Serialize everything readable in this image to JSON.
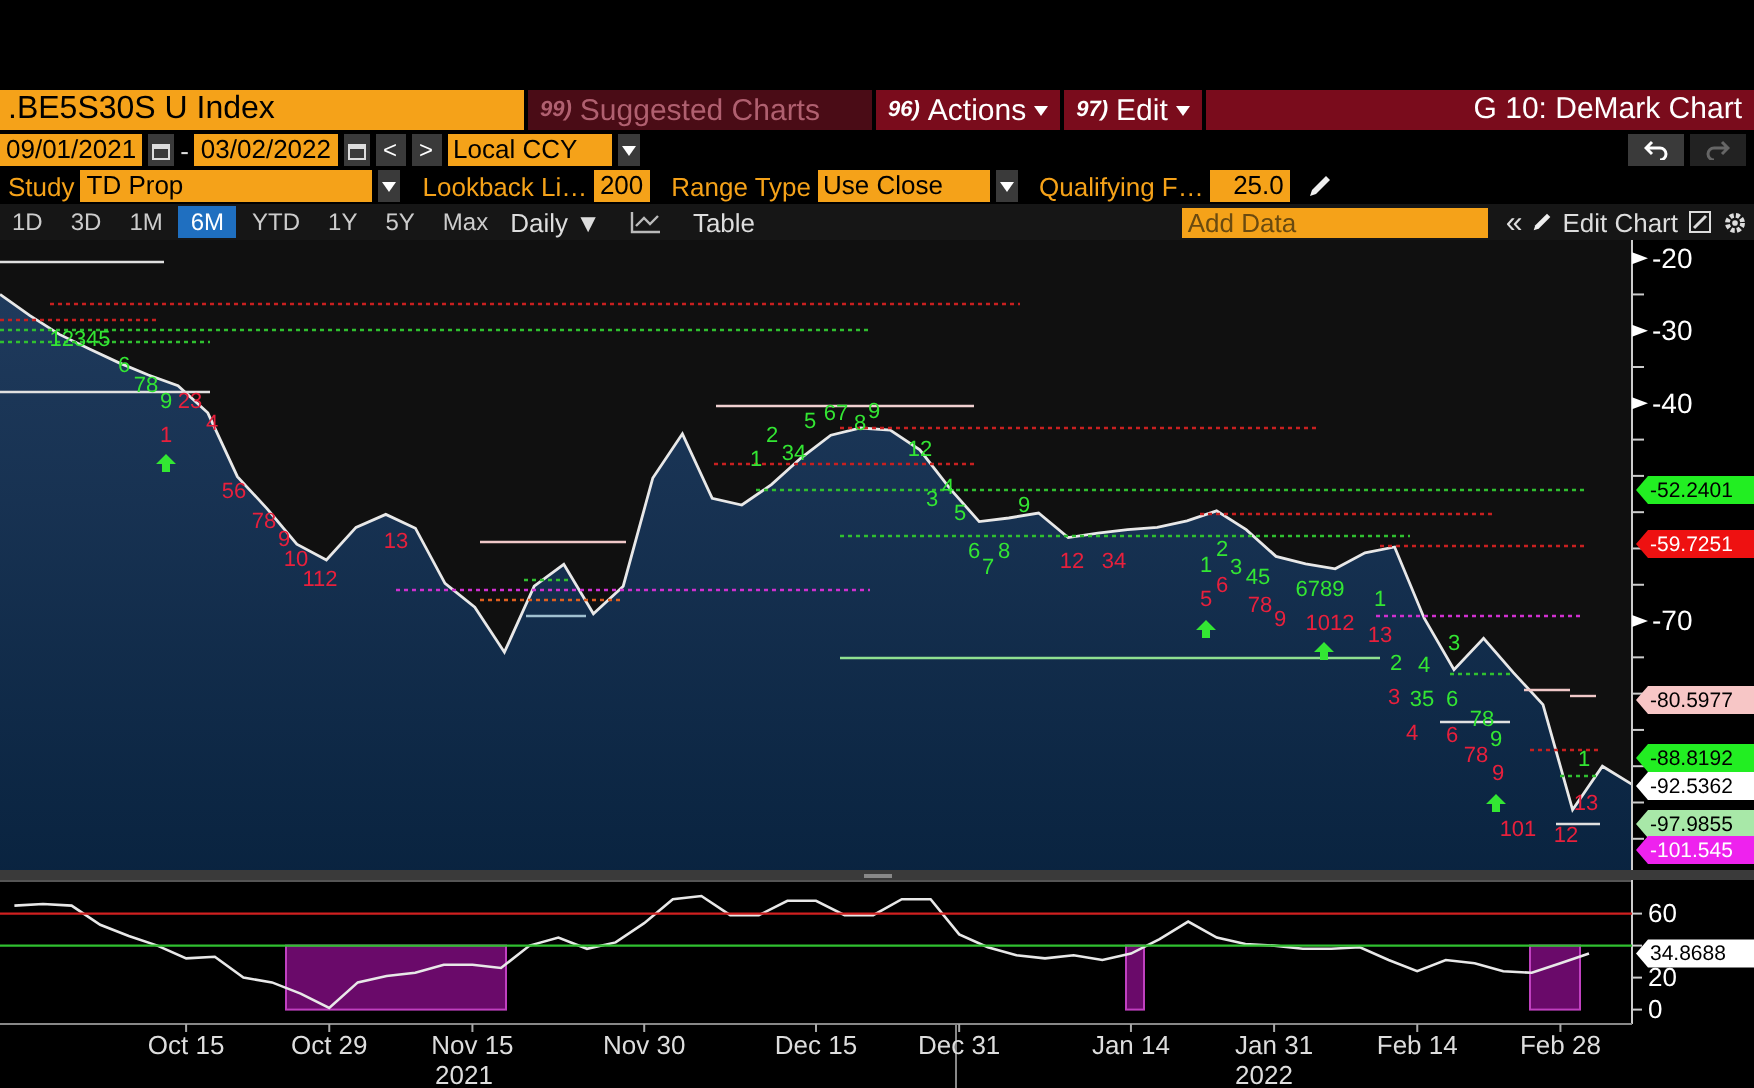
{
  "header": {
    "ticker": ".BE5S30S U Index",
    "menu": [
      {
        "number": "99)",
        "label": "Suggested Charts",
        "disabled": true
      },
      {
        "number": "96)",
        "label": "Actions",
        "disabled": false
      },
      {
        "number": "97)",
        "label": "Edit",
        "disabled": false
      }
    ],
    "title": "G 10: DeMark Chart"
  },
  "date_range": {
    "start": "09/01/2021",
    "separator": "-",
    "end": "03/02/2022",
    "prev": "<",
    "next": ">",
    "currency": "Local CCY"
  },
  "study_fields": [
    {
      "label": "Study",
      "value": "TD Prop",
      "kind": "dropdown"
    },
    {
      "label": "Lookback Li…",
      "value": "200",
      "kind": "input"
    },
    {
      "label": "Range Type",
      "value": "Use Close",
      "kind": "dropdown"
    },
    {
      "label": "Qualifying F…",
      "value": "25.0",
      "kind": "input"
    }
  ],
  "periods": [
    {
      "label": "1D",
      "selected": false
    },
    {
      "label": "3D",
      "selected": false
    },
    {
      "label": "1M",
      "selected": false
    },
    {
      "label": "6M",
      "selected": true
    },
    {
      "label": "YTD",
      "selected": false
    },
    {
      "label": "1Y",
      "selected": false
    },
    {
      "label": "5Y",
      "selected": false
    },
    {
      "label": "Max",
      "selected": false
    }
  ],
  "frequency": "Daily ▼",
  "table": "Table",
  "add_data": {
    "placeholder": "Add Data"
  },
  "collapse": "«",
  "edit_chart": "Edit Chart",
  "price_chart": {
    "chart_data": {
      "type": "area",
      "ylim": [
        -104.3,
        -17.5
      ],
      "yticks": [
        -20,
        -30,
        -40,
        -70
      ],
      "categories": [
        null,
        null,
        null,
        null,
        null,
        null,
        null,
        null,
        null,
        null,
        null,
        null,
        null,
        null,
        null,
        null,
        null,
        null,
        null,
        null,
        null,
        null,
        null,
        null,
        null,
        null,
        null,
        null,
        null,
        null,
        null,
        null,
        null,
        null,
        null,
        null,
        null,
        null,
        null,
        null,
        null,
        null,
        null,
        null,
        null,
        null,
        null,
        null,
        null,
        null,
        null,
        null,
        null,
        null,
        null,
        null
      ],
      "series": [
        {
          "color": "#e8e8e8",
          "values": [
            -25,
            -27.9,
            -30.5,
            -32.5,
            -34.4,
            -36.1,
            -37.6,
            -41.3,
            -50.1,
            -54.5,
            -59.4,
            -61.6,
            -57.1,
            -55.3,
            -57.2,
            -64.8,
            -68.1,
            -74.3,
            -65.2,
            -62.2,
            -69,
            -65.2,
            -50.3,
            -44.2,
            -53.1,
            -54,
            -51.2,
            -47.5,
            -44.4,
            -43.4,
            -43.7,
            -46.4,
            -51.7,
            -56.3,
            -55.8,
            -55.1,
            -58.5,
            -57.9,
            -57.4,
            -57.1,
            -56.2,
            -54.8,
            -57.4,
            -61.1,
            -62.1,
            -62.8,
            -60.6,
            -59.8,
            -69.6,
            -76.7,
            -72.4,
            -77.1,
            -81.5,
            -96,
            -90,
            -92.5
          ]
        }
      ]
    },
    "td_counts": [
      {
        "text": "12345",
        "color": "#33e633"
      },
      {
        "text": "6",
        "color": "#33e633"
      },
      {
        "text": "78",
        "color": "#33e633"
      },
      {
        "text": "9",
        "color": "#33e633"
      },
      {
        "text": "23",
        "color": "#e8203c"
      },
      {
        "text": "4",
        "color": "#e8203c"
      },
      {
        "text": "1",
        "color": "#e8203c"
      },
      {
        "text": "56",
        "color": "#e8203c"
      },
      {
        "text": "78",
        "color": "#e8203c"
      },
      {
        "text": "9",
        "color": "#e8203c"
      },
      {
        "text": "10",
        "color": "#e8203c"
      },
      {
        "text": "112",
        "color": "#e8203c"
      },
      {
        "text": "13",
        "color": "#e8203c"
      },
      {
        "text": "1",
        "color": "#33e633"
      },
      {
        "text": "2",
        "color": "#33e633"
      },
      {
        "text": "34",
        "color": "#33e633"
      },
      {
        "text": "5",
        "color": "#33e633"
      },
      {
        "text": "67",
        "color": "#33e633"
      },
      {
        "text": "8",
        "color": "#33e633"
      },
      {
        "text": "9",
        "color": "#33e633"
      },
      {
        "text": "12",
        "color": "#33e633"
      },
      {
        "text": "3",
        "color": "#33e633"
      },
      {
        "text": "4",
        "color": "#33e633"
      },
      {
        "text": "5",
        "color": "#33e633"
      },
      {
        "text": "6",
        "color": "#33e633"
      },
      {
        "text": "7",
        "color": "#33e633"
      },
      {
        "text": "8",
        "color": "#33e633"
      },
      {
        "text": "9",
        "color": "#33e633"
      },
      {
        "text": "12",
        "color": "#e8203c"
      },
      {
        "text": "34",
        "color": "#e8203c"
      },
      {
        "text": "1",
        "color": "#33e633"
      },
      {
        "text": "2",
        "color": "#33e633"
      },
      {
        "text": "3",
        "color": "#33e633"
      },
      {
        "text": "45",
        "color": "#33e633"
      },
      {
        "text": "6789",
        "color": "#33e633"
      },
      {
        "text": "5",
        "color": "#e8203c"
      },
      {
        "text": "6",
        "color": "#e8203c"
      },
      {
        "text": "78",
        "color": "#e8203c"
      },
      {
        "text": "9",
        "color": "#e8203c"
      },
      {
        "text": "1012",
        "color": "#e8203c"
      },
      {
        "text": "1",
        "color": "#33e633"
      },
      {
        "text": "13",
        "color": "#e8203c"
      },
      {
        "text": "2",
        "color": "#33e633"
      },
      {
        "text": "4",
        "color": "#33e633"
      },
      {
        "text": "3",
        "color": "#33e633"
      },
      {
        "text": "3",
        "color": "#e8203c"
      },
      {
        "text": "35",
        "color": "#33e633"
      },
      {
        "text": "4",
        "color": "#e8203c"
      },
      {
        "text": "6",
        "color": "#33e633"
      },
      {
        "text": "6",
        "color": "#e8203c"
      },
      {
        "text": "78",
        "color": "#33e633"
      },
      {
        "text": "78",
        "color": "#e8203c"
      },
      {
        "text": "9",
        "color": "#33e633"
      },
      {
        "text": "9",
        "color": "#e8203c"
      },
      {
        "text": "101",
        "color": "#e8203c"
      },
      {
        "text": "1",
        "color": "#33e633"
      },
      {
        "text": "13",
        "color": "#e8203c"
      },
      {
        "text": "12",
        "color": "#e8203c"
      }
    ],
    "price_tags": [
      {
        "text": "-52.2401",
        "color": "#22ee22"
      },
      {
        "text": "-59.7251",
        "color": "#ee1111"
      },
      {
        "text": "-80.5977",
        "color": "#f7c6c6"
      },
      {
        "text": "-88.8192",
        "color": "#22ee22"
      },
      {
        "text": "-92.5362",
        "color": "#ffffff"
      },
      {
        "text": "-97.9855",
        "color": "#a8e8a8"
      },
      {
        "text": "-101.545",
        "color": "#ee22ee"
      }
    ]
  },
  "oscillator_chart": {
    "chart_data": {
      "type": "line",
      "ylim": [
        -9,
        81
      ],
      "yticks": [
        60,
        20,
        0
      ],
      "categories": [
        null,
        null,
        null,
        null,
        null,
        null,
        "Oct 15",
        null,
        null,
        null,
        null,
        "Oct 29",
        null,
        null,
        null,
        null,
        "Nov 15",
        null,
        null,
        null,
        null,
        null,
        "Nov 30",
        null,
        null,
        null,
        null,
        null,
        "Dec 15",
        null,
        null,
        null,
        null,
        "Dec 31",
        null,
        null,
        null,
        null,
        null,
        "Jan 14",
        null,
        null,
        null,
        null,
        "Jan 31",
        null,
        null,
        null,
        null,
        "Feb 14",
        null,
        null,
        null,
        null,
        "Feb 28",
        null,
        null
      ],
      "series": [
        {
          "color": "#e8e8e8",
          "values": [
            65,
            66,
            65,
            53,
            46,
            40,
            32,
            33,
            20,
            17,
            10,
            1,
            17,
            21,
            23,
            28,
            28,
            26,
            40,
            45,
            38,
            42,
            54,
            69,
            71,
            59,
            59,
            68,
            68,
            59,
            59,
            69,
            69,
            47,
            39,
            34,
            32,
            34,
            31,
            35,
            44,
            55,
            45,
            41,
            40,
            38,
            38,
            39,
            31,
            24,
            31,
            29,
            24,
            23,
            29,
            35,
            null
          ]
        }
      ]
    },
    "value_tag": "34.8688"
  },
  "years": [
    "2021",
    "2022"
  ]
}
